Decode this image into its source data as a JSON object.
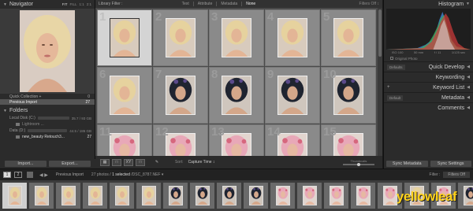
{
  "navigator": {
    "title": "Navigator",
    "zoom_options": [
      "FIT",
      "FILL",
      "1:1",
      "2:1"
    ],
    "active_zoom": 0
  },
  "catalog": {
    "rows": [
      {
        "label": "Quick Collection +",
        "count": "0"
      },
      {
        "label": "Previous Import",
        "count": "27"
      }
    ]
  },
  "folders": {
    "title": "Folders",
    "volumes": [
      {
        "label": "Local Disk (C:)",
        "info": "35.7 / 93 GB"
      },
      {
        "label": "Data (D:)",
        "info": "44.5 / 186 GB"
      }
    ],
    "subfolders": [
      {
        "label": "Lightroom ..."
      },
      {
        "label": "new_beauty Retouch3...",
        "count": "27"
      }
    ]
  },
  "left_buttons": {
    "import": "Import...",
    "export": "Export..."
  },
  "filter_bar": {
    "title": "Library Filter :",
    "items": [
      "Text",
      "Attribute",
      "Metadata",
      "None"
    ],
    "active": 3,
    "filters_off": "Filters Off ↕"
  },
  "grid": {
    "cells": [
      {
        "num": "1",
        "tone": "blonde",
        "selected": true
      },
      {
        "num": "2",
        "tone": "blonde"
      },
      {
        "num": "3",
        "tone": "blonde"
      },
      {
        "num": "4",
        "tone": "blonde"
      },
      {
        "num": "5",
        "tone": "blonde"
      },
      {
        "num": "6",
        "tone": "blonde"
      },
      {
        "num": "7",
        "tone": "dark"
      },
      {
        "num": "8",
        "tone": "dark"
      },
      {
        "num": "9",
        "tone": "dark"
      },
      {
        "num": "10",
        "tone": "dark"
      },
      {
        "num": "11",
        "tone": "pink"
      },
      {
        "num": "12",
        "tone": "pink"
      },
      {
        "num": "13",
        "tone": "pink"
      },
      {
        "num": "14",
        "tone": "pink"
      },
      {
        "num": "15",
        "tone": "pink"
      }
    ]
  },
  "toolbar": {
    "sort_label": "Sort:",
    "sort_value": "Capture Time ↕",
    "thumbnails_label": "Thumbnails",
    "thumbnail_size": 0.5
  },
  "histogram": {
    "title": "Histogram",
    "info": [
      "ISO 100",
      "50 mm",
      "f / 11",
      "1/125 sec"
    ],
    "original_photo": "Original Photo"
  },
  "right_panels": [
    {
      "label": "Quick Develop",
      "left": "Defaults",
      "kind": "dropdown"
    },
    {
      "label": "Keywording",
      "left": "",
      "kind": "none"
    },
    {
      "label": "Keyword List",
      "left": "+",
      "kind": "plus"
    },
    {
      "label": "Metadata",
      "left": "Default",
      "kind": "dropdown"
    },
    {
      "label": "Comments",
      "left": "",
      "kind": "none"
    }
  ],
  "right_buttons": {
    "sync_metadata": "Sync Metadata",
    "sync_settings": "Sync Settings"
  },
  "filmstrip_bar": {
    "screens": [
      "1",
      "2"
    ],
    "source": "Previous Import",
    "status_prefix": "27 photos /",
    "status_selected": "1 selected",
    "status_file": "/DSC_8787.NEF ▾",
    "filter_label": "Filter :",
    "filter_value": "Filters Off"
  },
  "filmstrip": {
    "count": 18,
    "selected_index": 0
  },
  "watermark": {
    "text": "yellowleaf"
  }
}
